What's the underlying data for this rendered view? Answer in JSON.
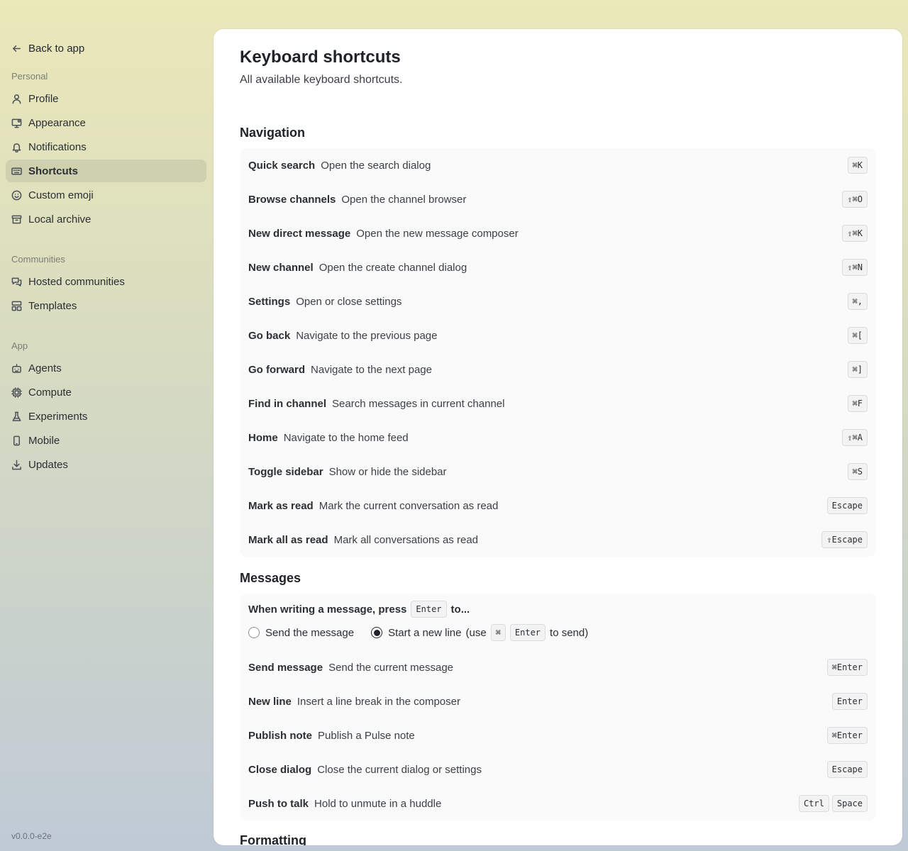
{
  "sidebar": {
    "back_label": "Back to app",
    "groups": [
      {
        "label": "Personal",
        "items": [
          {
            "label": "Profile",
            "icon": "user-icon"
          },
          {
            "label": "Appearance",
            "icon": "monitor-icon"
          },
          {
            "label": "Notifications",
            "icon": "bell-icon"
          },
          {
            "label": "Shortcuts",
            "icon": "keyboard-icon",
            "active": true
          },
          {
            "label": "Custom emoji",
            "icon": "smile-icon"
          },
          {
            "label": "Local archive",
            "icon": "archive-icon"
          }
        ]
      },
      {
        "label": "Communities",
        "items": [
          {
            "label": "Hosted communities",
            "icon": "chat-icon"
          },
          {
            "label": "Templates",
            "icon": "layout-icon"
          }
        ]
      },
      {
        "label": "App",
        "items": [
          {
            "label": "Agents",
            "icon": "bot-icon"
          },
          {
            "label": "Compute",
            "icon": "cpu-icon"
          },
          {
            "label": "Experiments",
            "icon": "flask-icon"
          },
          {
            "label": "Mobile",
            "icon": "phone-icon"
          },
          {
            "label": "Updates",
            "icon": "download-icon"
          }
        ]
      }
    ],
    "version": "v0.0.0-e2e"
  },
  "page": {
    "title": "Keyboard shortcuts",
    "subtitle": "All available keyboard shortcuts."
  },
  "navigation": {
    "title": "Navigation",
    "rows": [
      {
        "name": "Quick search",
        "desc": "Open the search dialog",
        "keys": [
          "⌘K"
        ]
      },
      {
        "name": "Browse channels",
        "desc": "Open the channel browser",
        "keys": [
          "⇧⌘O"
        ]
      },
      {
        "name": "New direct message",
        "desc": "Open the new message composer",
        "keys": [
          "⇧⌘K"
        ]
      },
      {
        "name": "New channel",
        "desc": "Open the create channel dialog",
        "keys": [
          "⇧⌘N"
        ]
      },
      {
        "name": "Settings",
        "desc": "Open or close settings",
        "keys": [
          "⌘,"
        ]
      },
      {
        "name": "Go back",
        "desc": "Navigate to the previous page",
        "keys": [
          "⌘["
        ]
      },
      {
        "name": "Go forward",
        "desc": "Navigate to the next page",
        "keys": [
          "⌘]"
        ]
      },
      {
        "name": "Find in channel",
        "desc": "Search messages in current channel",
        "keys": [
          "⌘F"
        ]
      },
      {
        "name": "Home",
        "desc": "Navigate to the home feed",
        "keys": [
          "⇧⌘A"
        ]
      },
      {
        "name": "Toggle sidebar",
        "desc": "Show or hide the sidebar",
        "keys": [
          "⌘S"
        ]
      },
      {
        "name": "Mark as read",
        "desc": "Mark the current conversation as read",
        "keys": [
          "Escape"
        ]
      },
      {
        "name": "Mark all as read",
        "desc": "Mark all conversations as read",
        "keys": [
          "⇧Escape"
        ]
      }
    ]
  },
  "messages": {
    "title": "Messages",
    "pref_before": "When writing a message, press",
    "pref_key": "Enter",
    "pref_after": "to...",
    "option_send": "Send the message",
    "option_newline": "Start a new line",
    "selected": "newline",
    "hint_open": "(use",
    "hint_key1": "⌘",
    "hint_key2": "Enter",
    "hint_close": "to send)",
    "rows": [
      {
        "name": "Send message",
        "desc": "Send the current message",
        "keys": [
          "⌘Enter"
        ]
      },
      {
        "name": "New line",
        "desc": "Insert a line break in the composer",
        "keys": [
          "Enter"
        ]
      },
      {
        "name": "Publish note",
        "desc": "Publish a Pulse note",
        "keys": [
          "⌘Enter"
        ]
      },
      {
        "name": "Close dialog",
        "desc": "Close the current dialog or settings",
        "keys": [
          "Escape"
        ]
      },
      {
        "name": "Push to talk",
        "desc": "Hold to unmute in a huddle",
        "keys": [
          "Ctrl",
          "Space"
        ]
      }
    ]
  },
  "formatting": {
    "title": "Formatting"
  }
}
